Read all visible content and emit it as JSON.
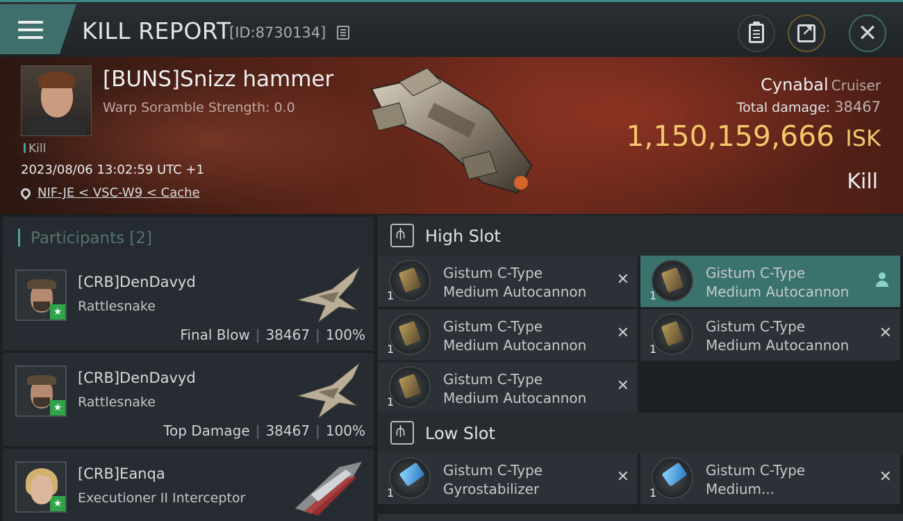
{
  "header": {
    "title": "KILL REPORT",
    "report_id": "[ID:8730134]"
  },
  "victim": {
    "name": "[BUNS]Snizz hammer",
    "scramble": "Warp Soramble Strength: 0.0",
    "kill_tag": "Kill",
    "datetime": "2023/08/06 13:02:59 UTC +1",
    "location": "NIF-JE < VSC-W9 < Cache",
    "ship_name": "Cynabal",
    "ship_class": "Cruiser",
    "total_damage_label": "Total damage:",
    "total_damage": "38467",
    "isk_value": "1,150,159,666",
    "isk_unit": "ISK",
    "result": "Kill"
  },
  "participants": {
    "title": "Participants [2]",
    "rows": [
      {
        "name": "[CRB]DenDavyd",
        "ship": "Rattlesnake",
        "role": "Final Blow",
        "damage": "38467",
        "percent": "100%"
      },
      {
        "name": "[CRB]DenDavyd",
        "ship": "Rattlesnake",
        "role": "Top Damage",
        "damage": "38467",
        "percent": "100%"
      },
      {
        "name": "[CRB]Eanqa",
        "ship": "Executioner II Interceptor"
      }
    ]
  },
  "high_slot": {
    "title": "High Slot",
    "modules": [
      {
        "qty": "1",
        "line1": "Gistum C-Type",
        "line2": "Medium Autocannon",
        "icon": "autocannon-icon"
      },
      {
        "qty": "1",
        "line1": "Gistum C-Type",
        "line2": "Medium Autocannon",
        "icon": "autocannon-icon",
        "active": true
      },
      {
        "qty": "1",
        "line1": "Gistum C-Type",
        "line2": "Medium Autocannon",
        "icon": "autocannon-icon"
      },
      {
        "qty": "1",
        "line1": "Gistum C-Type",
        "line2": "Medium Autocannon",
        "icon": "autocannon-icon"
      },
      {
        "qty": "1",
        "line1": "Gistum C-Type",
        "line2": "Medium Autocannon",
        "icon": "autocannon-icon"
      }
    ]
  },
  "low_slot": {
    "title": "Low Slot",
    "modules": [
      {
        "qty": "1",
        "line1": "Gistum C-Type",
        "line2": "Gyrostabilizer",
        "icon": "gyrostabilizer-icon"
      },
      {
        "qty": "1",
        "line1": "Gistum C-Type",
        "line2": "Medium...",
        "icon": "shield-module-icon"
      }
    ]
  },
  "colors": {
    "accent_teal": "#3e6f6c",
    "isk_gold": "#f3c76a",
    "active_module": "#3a726e",
    "star_green": "#2fa44a"
  }
}
